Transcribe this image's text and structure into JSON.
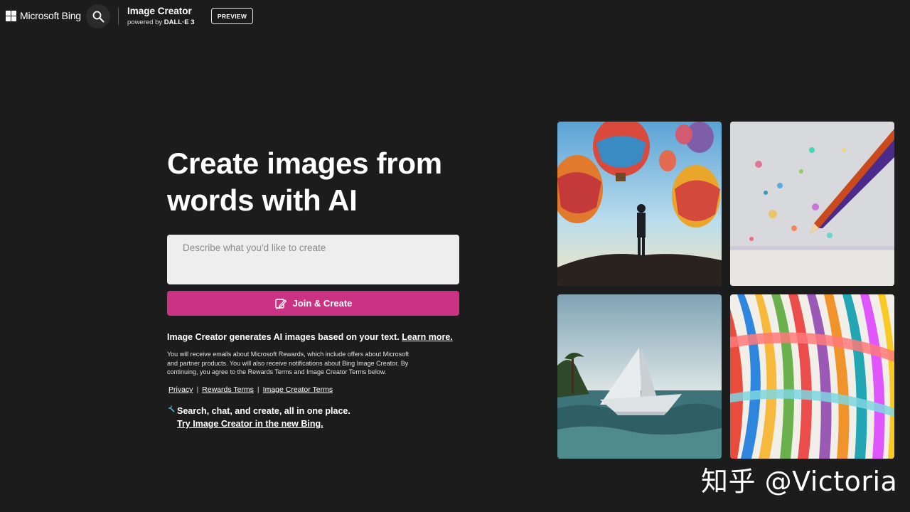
{
  "header": {
    "brand": "Microsoft Bing",
    "product_name": "Image Creator",
    "product_sub_prefix": "powered by",
    "product_sub_model": "DALL·E 3",
    "preview_label": "PREVIEW"
  },
  "main": {
    "headline_line1": "Create images from",
    "headline_line2": "words with AI",
    "prompt_placeholder": "Describe what you'd like to create",
    "create_button_label": "Join & Create",
    "info_text": "Image Creator generates AI images based on your text.",
    "info_link": "Learn more.",
    "fine_print": "You will receive emails about Microsoft Rewards, which include offers about Microsoft and partner products. You will also receive notifications about Bing Image Creator. By continuing, you agree to the Rewards Terms and Image Creator Terms below.",
    "links": [
      "Privacy",
      "Rewards Terms",
      "Image Creator Terms"
    ],
    "promo_text": "Search, chat, and create, all in one place.",
    "promo_link": "Try Image Creator in the new Bing."
  },
  "watermark": "知乎 @Victoria",
  "colors": {
    "background": "#1c1c1c",
    "accent": "#cb3283",
    "prompt_bg": "#eeeeee"
  }
}
